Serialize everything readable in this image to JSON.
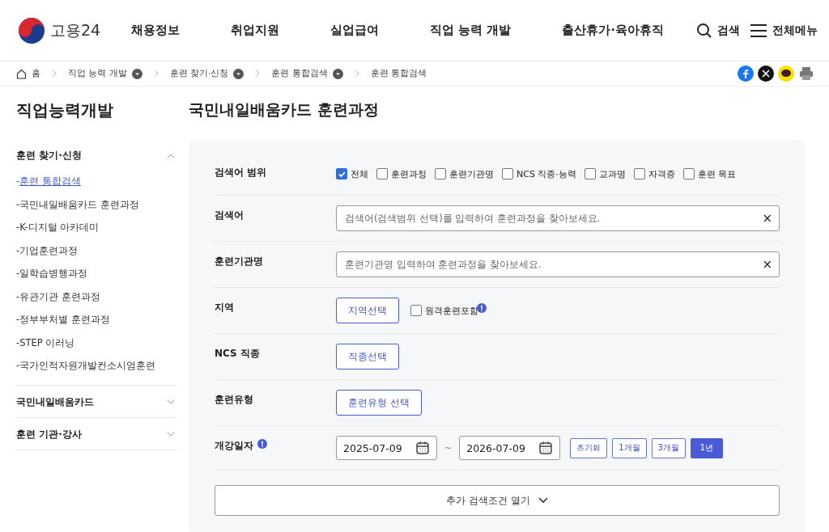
{
  "header": {
    "logo_text": "고용24",
    "nav": [
      "채용정보",
      "취업지원",
      "실업급여",
      "직업 능력 개발",
      "출산휴가·육아휴직"
    ],
    "search_label": "검색",
    "menu_label": "전체메뉴"
  },
  "breadcrumb": {
    "home": "홈",
    "items": [
      {
        "label": "직업 능력 개발",
        "dropdown": true
      },
      {
        "label": "훈련 찾기·신청",
        "dropdown": true
      },
      {
        "label": "훈련 통합검색",
        "dropdown": true
      },
      {
        "label": "훈련 통합검색",
        "dropdown": false
      }
    ]
  },
  "sidebar": {
    "title": "직업능력개발",
    "bullet": "-",
    "sections": [
      {
        "label": "훈련 찾기·신청",
        "expanded": true,
        "children": [
          {
            "label": "훈련 통합검색",
            "selected": true
          },
          {
            "label": "국민내일배움카드 훈련과정",
            "selected": false
          },
          {
            "label": "K-디지털 아카데미",
            "selected": false
          },
          {
            "label": "기업훈련과정",
            "selected": false
          },
          {
            "label": "일학습병행과정",
            "selected": false
          },
          {
            "label": "유관기관 훈련과정",
            "selected": false
          },
          {
            "label": "정부부처별 훈련과정",
            "selected": false
          },
          {
            "label": "STEP 이러닝",
            "selected": false
          },
          {
            "label": "국가인적자원개발컨소시엄훈련",
            "selected": false
          }
        ]
      },
      {
        "label": "국민내일배움카드",
        "expanded": false
      },
      {
        "label": "훈련 기관·강사",
        "expanded": false
      }
    ]
  },
  "page_title": "국민내일배움카드 훈련과정",
  "form": {
    "rows": [
      {
        "kind": "checkboxes",
        "label": "검색어 범위",
        "options": [
          {
            "label": "전체",
            "checked": true
          },
          {
            "label": "훈련과정",
            "checked": false
          },
          {
            "label": "훈련기관명",
            "checked": false
          },
          {
            "label": "NCS 직종·능력",
            "checked": false
          },
          {
            "label": "교과명",
            "checked": false
          },
          {
            "label": "자격증",
            "checked": false
          },
          {
            "label": "훈련 목표",
            "checked": false
          }
        ]
      },
      {
        "kind": "text",
        "label": "검색어",
        "placeholder": "검색어(검색범위 선택)를 입력하여 훈련과정을 찾아보세요.",
        "clear": "×"
      },
      {
        "kind": "text",
        "label": "훈련기관명",
        "placeholder": "훈련기관명 입력하여 훈련과정을 찾아보세요.",
        "clear": "×"
      },
      {
        "kind": "select",
        "label": "지역",
        "button": "지역선택",
        "checkbox": {
          "label": "원격훈련포함",
          "checked": false
        },
        "info": true
      },
      {
        "kind": "select",
        "label": "NCS 직종",
        "button": "직종선택"
      },
      {
        "kind": "select",
        "label": "훈련유형",
        "button": "훈련유형 선택"
      },
      {
        "kind": "dates",
        "label": "개강일자",
        "info": true,
        "from": "2025-07-09",
        "to": "2026-07-09",
        "separator": "~",
        "presets": [
          {
            "label": "초기화",
            "selected": false
          },
          {
            "label": "1개월",
            "selected": false
          },
          {
            "label": "3개월",
            "selected": false
          },
          {
            "label": "1년",
            "selected": true
          }
        ]
      }
    ],
    "more_button": "추가 검색조건 열기"
  }
}
